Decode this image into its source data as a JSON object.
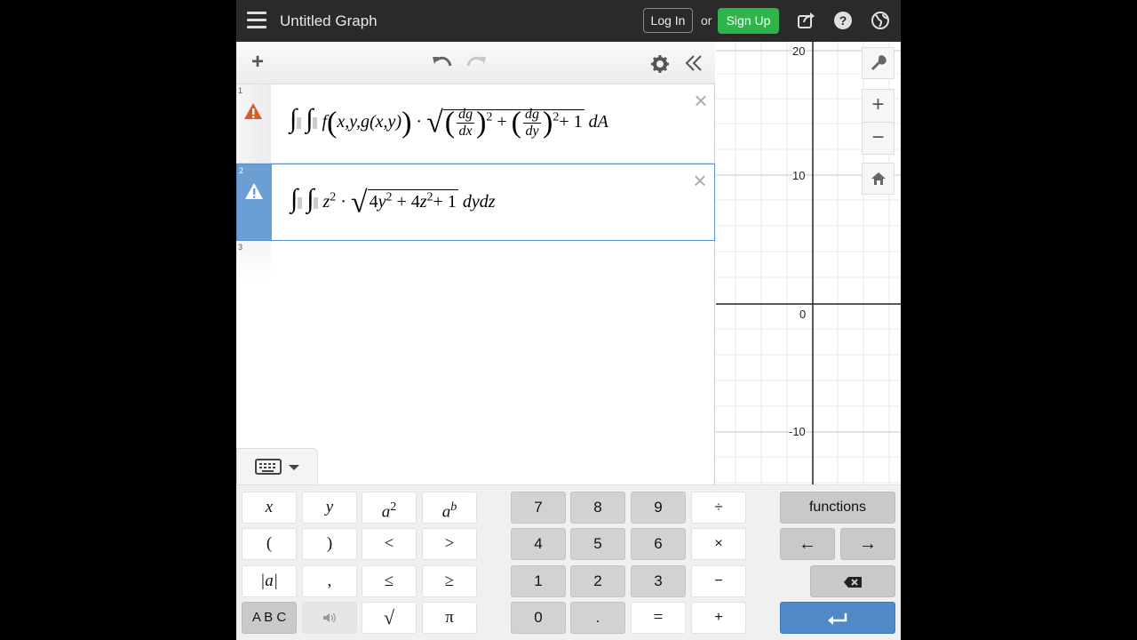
{
  "header": {
    "title": "Untitled Graph",
    "login_label": "Log In",
    "or_label": "or",
    "signup_label": "Sign Up"
  },
  "expressions": [
    {
      "number": "1",
      "status": "warning",
      "active": false,
      "integrand_fn": "f",
      "integrand_args": "x,y,g(x,y)",
      "frac1_num": "dg",
      "frac1_den": "dx",
      "frac2_num": "dg",
      "frac2_den": "dy",
      "exponent": "2",
      "plus_one": "+ 1",
      "differential": "dA"
    },
    {
      "number": "2",
      "status": "warning",
      "active": true,
      "integrand": "z",
      "exponent": "2",
      "radicand_a": "4y",
      "radicand_b": "4z",
      "plus_one": "+ 1",
      "differential": "dydz"
    },
    {
      "number": "3",
      "status": "empty",
      "active": false
    }
  ],
  "graph": {
    "y_ticks": [
      "20",
      "10",
      "0",
      "-10"
    ]
  },
  "keypad": {
    "row1": [
      "x",
      "y",
      "a",
      "a",
      "7",
      "8",
      "9",
      "÷",
      "functions"
    ],
    "row2": [
      "(",
      ")",
      "<",
      ">",
      "4",
      "5",
      "6",
      "×",
      "←",
      "→"
    ],
    "row3": [
      "|a|",
      ",",
      "≤",
      "≥",
      "1",
      "2",
      "3",
      "−"
    ],
    "row4": [
      "A B C",
      "√",
      "π",
      "0",
      ".",
      "=",
      "+"
    ],
    "sup_2": "2",
    "sup_b": "b"
  },
  "colors": {
    "header_bg": "#2a2a2a",
    "signup_green": "#2fb34b",
    "active_blue": "#6b9ed2",
    "warning_orange": "#e0582a",
    "enter_blue": "#4f8ac6"
  }
}
